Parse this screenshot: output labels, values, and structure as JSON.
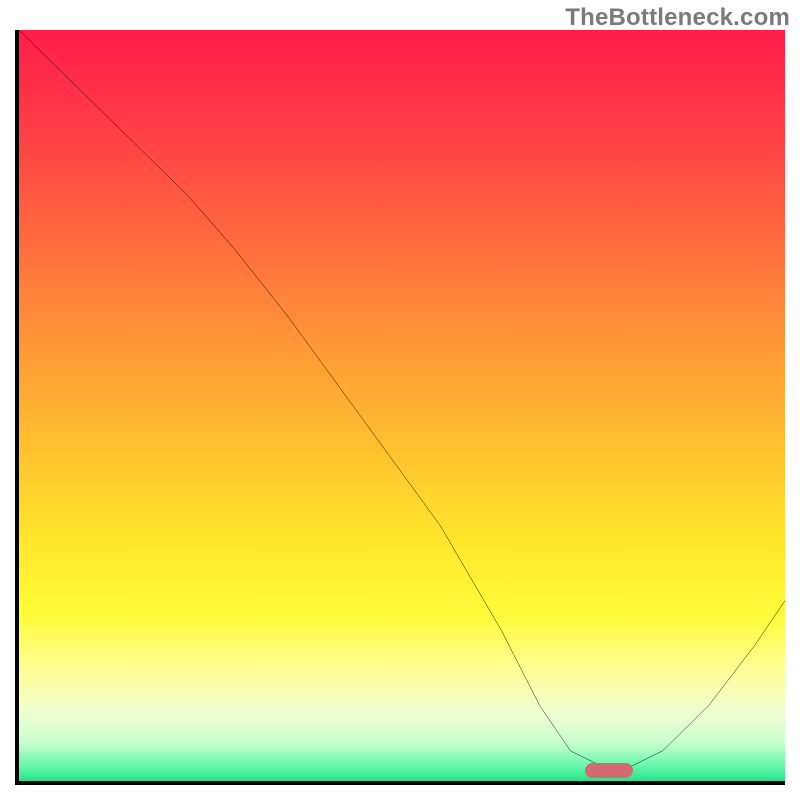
{
  "watermark": "TheBottleneck.com",
  "chart_data": {
    "type": "line",
    "title": "",
    "xlabel": "",
    "ylabel": "",
    "xlim": [
      0,
      100
    ],
    "ylim": [
      0,
      100
    ],
    "grid": false,
    "series": [
      {
        "name": "bottleneck-curve",
        "x": [
          0,
          8,
          22,
          28,
          35,
          45,
          55,
          63,
          68,
          72,
          76,
          80,
          84,
          90,
          96,
          100
        ],
        "values": [
          100,
          92,
          78,
          71,
          62,
          48,
          34,
          20,
          10,
          4,
          2,
          2,
          4,
          10,
          18,
          24
        ]
      }
    ],
    "marker": {
      "name": "optimal-range",
      "x_center": 77,
      "y": 1.5,
      "color": "#d46a6f"
    },
    "background": {
      "type": "vertical-gradient",
      "stops": [
        {
          "pos": 0,
          "color": "#ff1d49"
        },
        {
          "pos": 28,
          "color": "#ff6a3e"
        },
        {
          "pos": 56,
          "color": "#ffc22f"
        },
        {
          "pos": 78,
          "color": "#fffb3a"
        },
        {
          "pos": 95,
          "color": "#c6ffcf"
        },
        {
          "pos": 100,
          "color": "#26e38f"
        }
      ]
    }
  }
}
